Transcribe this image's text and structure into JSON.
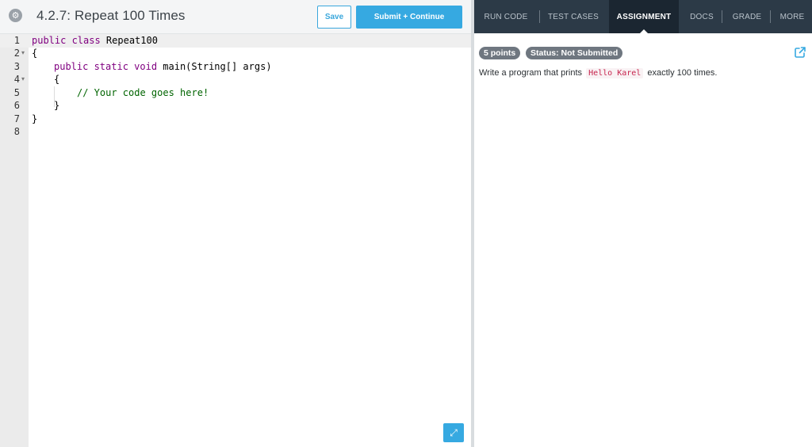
{
  "header": {
    "settings_icon": "gear-icon",
    "title": "4.2.7: Repeat 100 Times",
    "save_label": "Save",
    "submit_label": "Submit + Continue",
    "accent_color": "#36a9e1"
  },
  "editor": {
    "lines": [
      {
        "number": "1",
        "fold": ""
      },
      {
        "number": "2",
        "fold": "▾"
      },
      {
        "number": "3",
        "fold": ""
      },
      {
        "number": "4",
        "fold": "▾"
      },
      {
        "number": "5",
        "fold": ""
      },
      {
        "number": "6",
        "fold": ""
      },
      {
        "number": "7",
        "fold": ""
      },
      {
        "number": "8",
        "fold": ""
      }
    ],
    "code": {
      "l1_kw": "public class",
      "l1_rest": " Repeat100",
      "l2": "{",
      "l3_kw": "public static void",
      "l3_rest": " main(String[] args)",
      "l4": "{",
      "l5": "// Your code goes here!",
      "l6": "}",
      "l7": "}"
    },
    "expand_icon": "expand-icon"
  },
  "tabs": {
    "run_code": "RUN CODE",
    "test_cases": "TEST CASES",
    "assignment": "ASSIGNMENT",
    "docs": "DOCS",
    "grade": "GRADE",
    "more": "MORE",
    "active": "ASSIGNMENT"
  },
  "assignment": {
    "points_badge": "5 points",
    "status_badge": "Status: Not Submitted",
    "external_link_icon": "external-link-icon",
    "description_before": "Write a program that prints",
    "description_code": "Hello Karel",
    "description_after": "exactly 100 times."
  }
}
